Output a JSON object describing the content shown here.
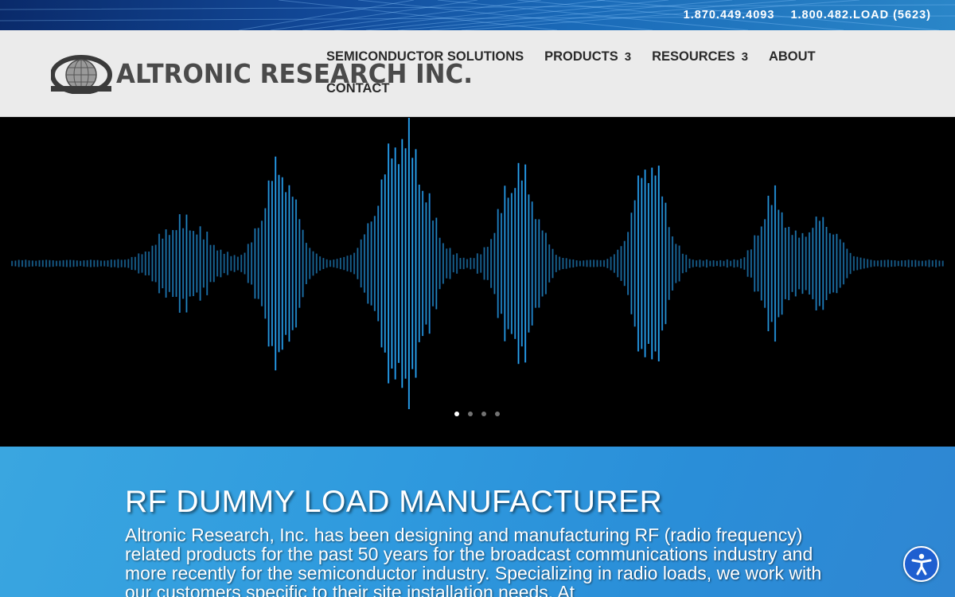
{
  "topbar": {
    "phone_1": "1.870.449.4093",
    "phone_2": "1.800.482.LOAD (5623)"
  },
  "header": {
    "logo_text": "ALTRONIC RESEARCH INC.",
    "logo_icon": "globe-icon"
  },
  "nav": {
    "items": [
      {
        "label": "SEMICONDUCTOR SOLUTIONS",
        "caret": ""
      },
      {
        "label": "PRODUCTS",
        "caret": "3"
      },
      {
        "label": "RESOURCES",
        "caret": "3"
      },
      {
        "label": "ABOUT",
        "caret": ""
      },
      {
        "label": "CONTACT",
        "caret": ""
      }
    ]
  },
  "hero": {
    "image": "sound-waveform",
    "slides_total": 4,
    "active_slide": 1
  },
  "intro": {
    "title": "RF DUMMY LOAD MANUFACTURER",
    "body": "Altronic Research, Inc. has been designing and manufacturing RF (radio frequency) related products for the past 50 years for the broadcast communications industry and more recently for the semiconductor industry.  Specializing in radio loads, we work with our customers specific to their site installation needs.  At"
  },
  "accessibility": {
    "icon": "accessibility-icon",
    "color": "#1e5fd0"
  },
  "colors": {
    "intro_bg": "#2f9ade",
    "header_bg": "#ebebeb",
    "nav_text": "#2a2a2a"
  }
}
